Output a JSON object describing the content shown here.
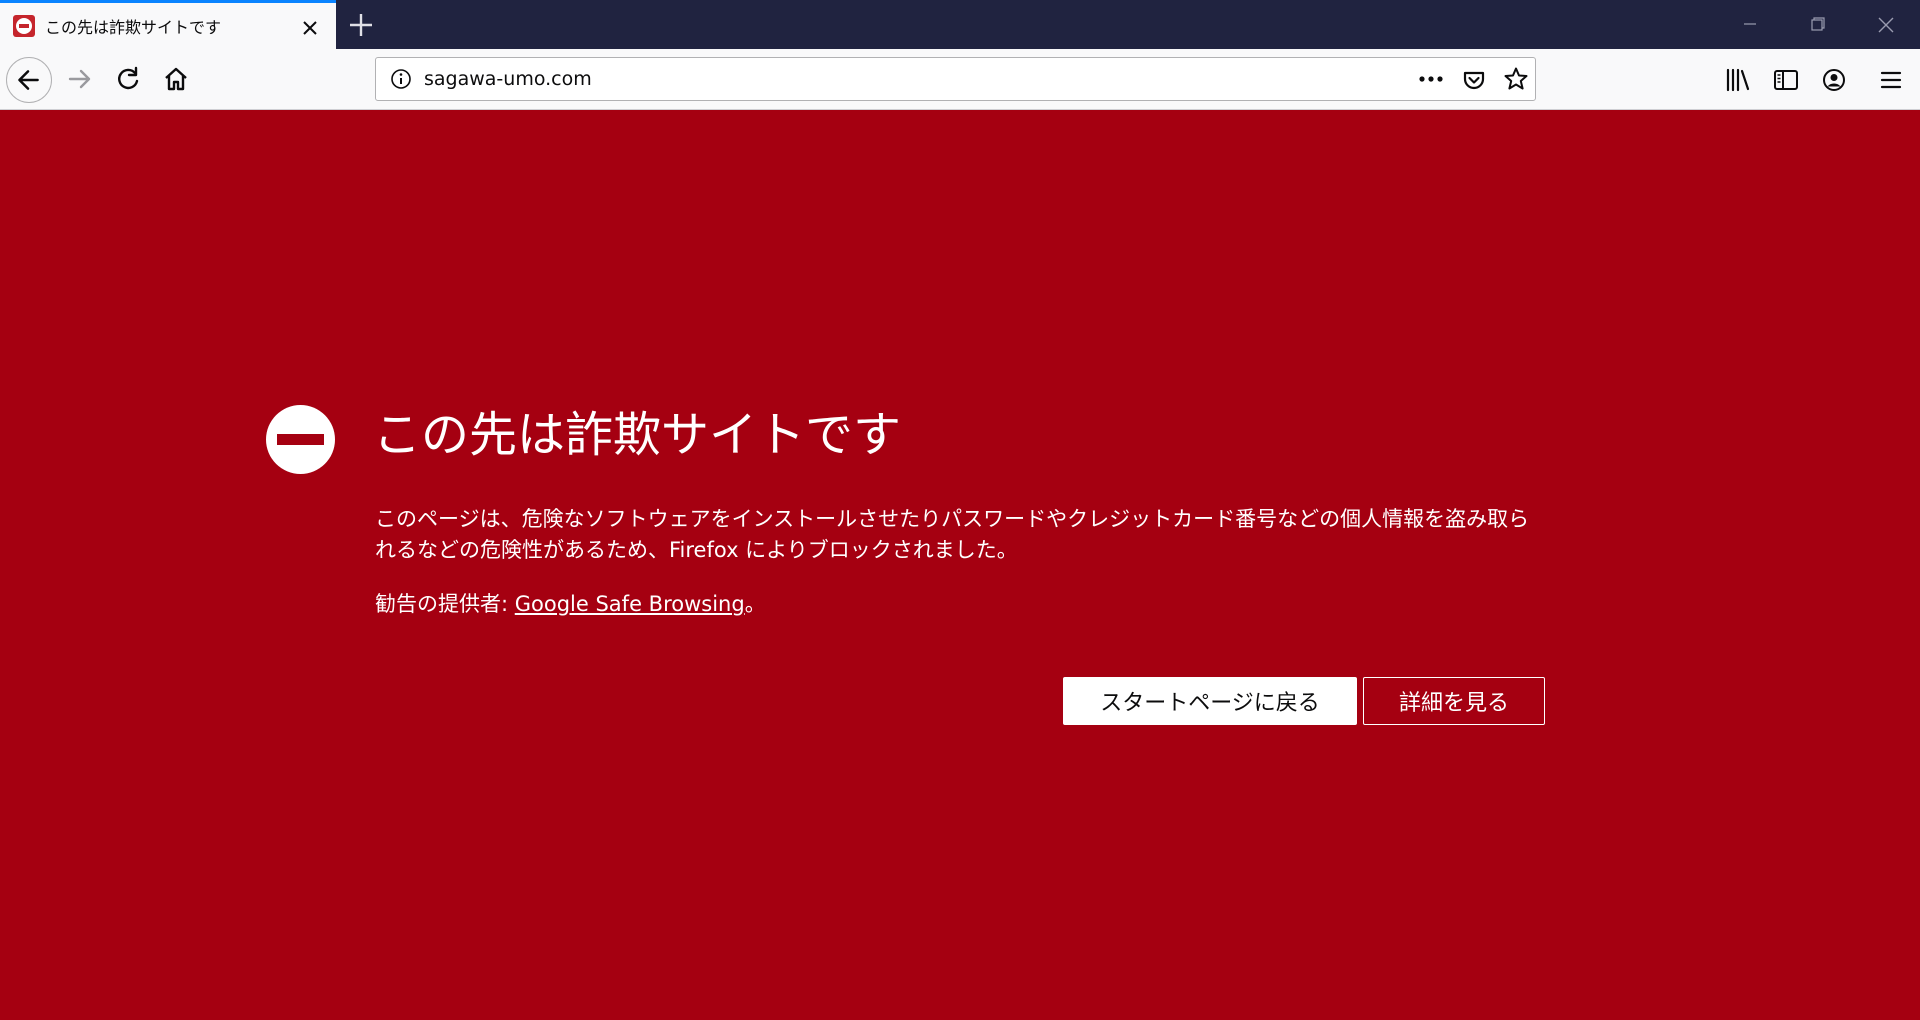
{
  "colors": {
    "page_background": "#a50011",
    "tabstrip_background": "#202340",
    "toolbar_background": "#f9f9fa",
    "tab_accent": "#0a84ff"
  },
  "tab": {
    "title": "この先は詐欺サイトです",
    "favicon": "blocked-site-icon",
    "close_icon": "close-icon"
  },
  "toolbar": {
    "new_tab_icon": "plus-icon",
    "back_icon": "arrow-left-icon",
    "forward_icon": "arrow-right-icon",
    "reload_icon": "reload-icon",
    "home_icon": "home-icon",
    "library_icon": "library-icon",
    "sidebar_icon": "sidebar-icon",
    "account_icon": "account-icon",
    "menu_icon": "hamburger-menu-icon"
  },
  "urlbar": {
    "url": "sagawa-umo.com",
    "info_icon": "info-icon",
    "page_actions_icon": "more-dots-icon",
    "pocket_icon": "pocket-icon",
    "bookmark_icon": "star-icon"
  },
  "error_page": {
    "icon": "blocked-icon",
    "title": "この先は詐欺サイトです",
    "description": "このページは、危険なソフトウェアをインストールさせたりパスワードやクレジットカード番号などの個人情報を盗み取られるなどの危険性があるため、Firefox によりブロックされました。",
    "advisory_prefix": "勧告の提供者: ",
    "advisory_link": "Google Safe Browsing",
    "advisory_suffix": "。",
    "go_back_button": "スタートページに戻る",
    "details_button": "詳細を見る"
  }
}
